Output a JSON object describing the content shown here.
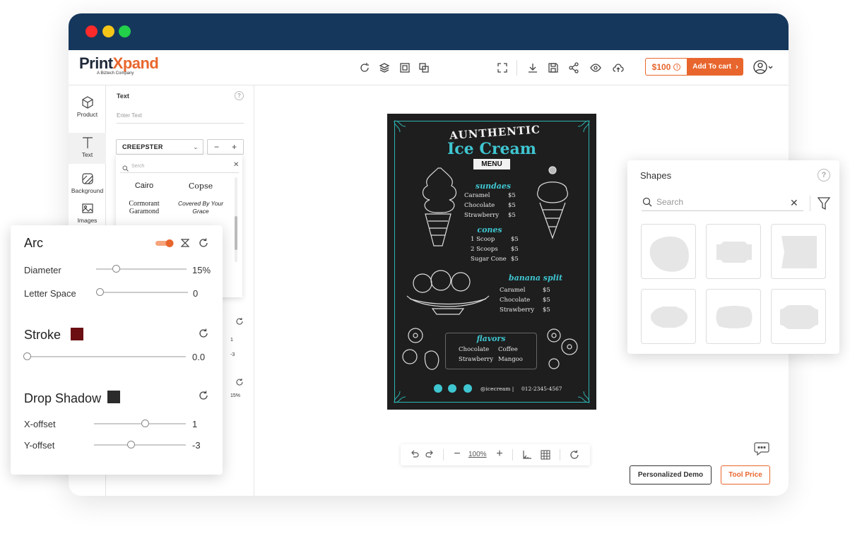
{
  "brand": {
    "name_part1": "Print",
    "name_part2": "X",
    "name_part3": "pand",
    "tagline": "A Biztech Company",
    "accent_color": "#e8662d",
    "titlebar_color": "#16375c"
  },
  "header": {
    "price": "$100",
    "add_to_cart": "Add To cart",
    "icons": [
      "refresh-icon",
      "layers-icon",
      "copy-icon",
      "duplicate-icon",
      "fullscreen-icon",
      "download-icon",
      "save-icon",
      "share-icon",
      "preview-icon",
      "cloud-upload-icon",
      "user-icon"
    ]
  },
  "sidebar": {
    "items": [
      {
        "label": "Product"
      },
      {
        "label": "Text"
      },
      {
        "label": "Background"
      },
      {
        "label": "Images"
      }
    ]
  },
  "text_panel": {
    "title": "Text",
    "input_placeholder": "Enter Text",
    "font_selected": "CREEPSTER",
    "font_search_placeholder": "Serch",
    "fonts": [
      "Cairo",
      "Copse",
      "Cormorant Garamond",
      "Covered By Your Grace"
    ],
    "bg_values": [
      "1",
      "-3",
      "15%"
    ]
  },
  "arc_panel": {
    "arc": {
      "title": "Arc",
      "toggle_on": true
    },
    "diameter": {
      "label": "Diameter",
      "value": "15%",
      "fraction": 0.22
    },
    "letter_space": {
      "label": "Letter Space",
      "value": "0",
      "fraction": 0.0
    },
    "stroke": {
      "title": "Stroke",
      "color": "#6b0f12",
      "value": "0.0",
      "fraction": 0.0
    },
    "drop_shadow": {
      "title": "Drop Shadow",
      "color": "#2b2b2b"
    },
    "x_offset": {
      "label": "X-offset",
      "value": "1",
      "fraction": 0.55
    },
    "y_offset": {
      "label": "Y-offset",
      "value": "-3",
      "fraction": 0.4
    }
  },
  "shapes_panel": {
    "title": "Shapes",
    "search_placeholder": "Search",
    "tile_count": 6
  },
  "menu_card": {
    "title_top": "AUNTHENTIC",
    "title_main": "Ice Cream",
    "title_ribbon": "MENU",
    "sections": [
      {
        "heading": "sundaes",
        "items": [
          {
            "name": "Caramel",
            "price": "$5"
          },
          {
            "name": "Chocolate",
            "price": "$5"
          },
          {
            "name": "Strawberry",
            "price": "$5"
          }
        ]
      },
      {
        "heading": "cones",
        "items": [
          {
            "name": "1 Scoop",
            "price": "$5"
          },
          {
            "name": "2 Scoops",
            "price": "$5"
          },
          {
            "name": "Sugar Cone",
            "price": "$5"
          }
        ]
      },
      {
        "heading": "banana split",
        "items": [
          {
            "name": "Caramel",
            "price": "$5"
          },
          {
            "name": "Chocolate",
            "price": "$5"
          },
          {
            "name": "Strawberry",
            "price": "$5"
          }
        ]
      }
    ],
    "flavors": {
      "heading": "flavors",
      "items": [
        "Chocolate",
        "Coffee",
        "Strawberry",
        "Mangoo"
      ]
    },
    "handle": "@icecream |",
    "phone": "012-2345-4567"
  },
  "bottom_toolbar": {
    "zoom": "100%"
  },
  "buttons": {
    "demo": "Personalized Demo",
    "tool_price": "Tool Price"
  }
}
